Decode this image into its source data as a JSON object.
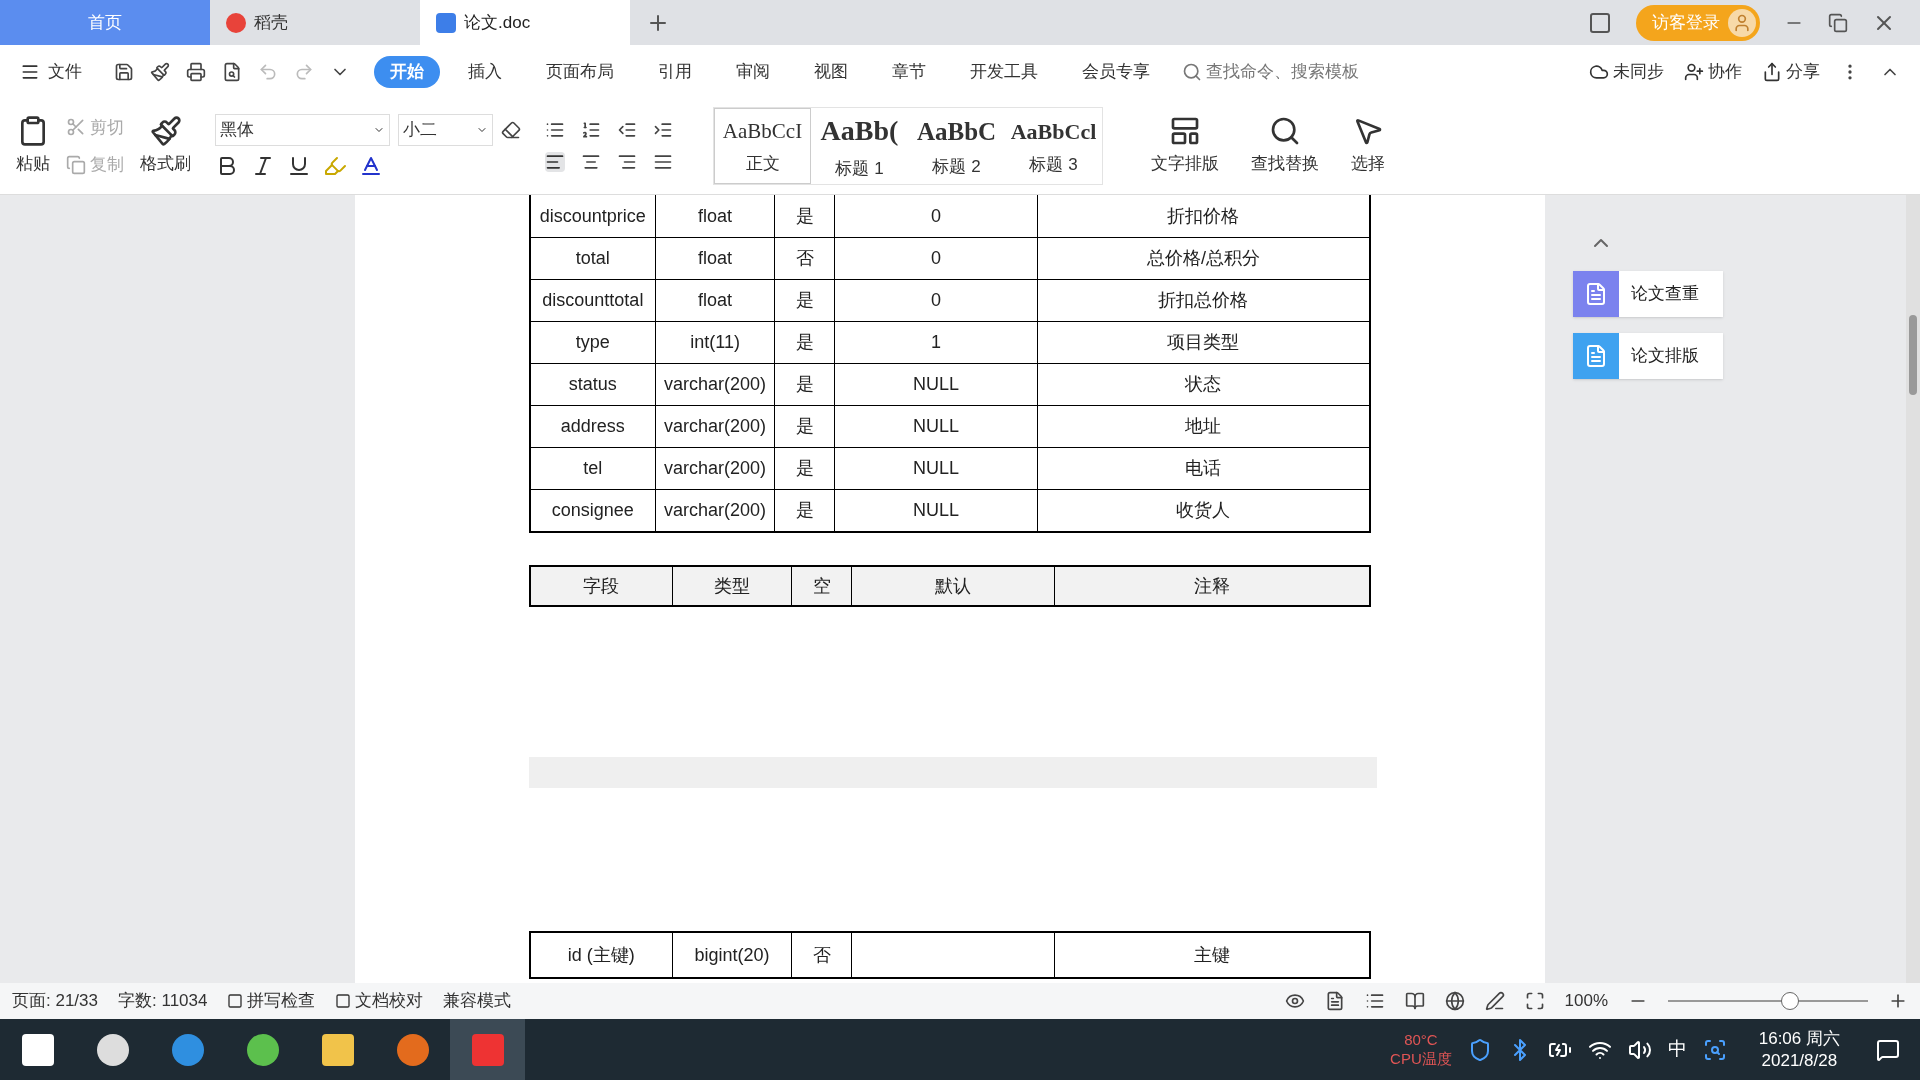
{
  "doc_tabs": [
    {
      "label": "首页",
      "kind": "home",
      "selected": false
    },
    {
      "label": "稻壳",
      "kind": "docer",
      "selected": false
    },
    {
      "label": "论文.doc",
      "kind": "doc",
      "selected": true
    }
  ],
  "login_button": "访客登录",
  "file_menu": "文件",
  "ribbon_tabs": [
    {
      "label": "开始",
      "selected": true
    },
    {
      "label": "插入",
      "selected": false
    },
    {
      "label": "页面布局",
      "selected": false
    },
    {
      "label": "引用",
      "selected": false
    },
    {
      "label": "审阅",
      "selected": false
    },
    {
      "label": "视图",
      "selected": false
    },
    {
      "label": "章节",
      "selected": false
    },
    {
      "label": "开发工具",
      "selected": false
    },
    {
      "label": "会员专享",
      "selected": false
    }
  ],
  "command_search": {
    "placeholder": "查找命令、搜索模板"
  },
  "top_actions": [
    "未同步",
    "协作",
    "分享"
  ],
  "clipboard": {
    "paste": "粘贴",
    "cut": "剪切",
    "copy": "复制",
    "format_painter": "格式刷"
  },
  "font": {
    "family": "黑体",
    "size": "小二",
    "bold": false,
    "italic": false,
    "underline": false
  },
  "styles": [
    {
      "sample": "AaBbCcI",
      "name": "正文",
      "kind": "body",
      "selected": true
    },
    {
      "sample": "AaBb(",
      "name": "标题 1",
      "kind": "h1",
      "selected": false
    },
    {
      "sample": "AaBbC",
      "name": "标题 2",
      "kind": "h2",
      "selected": false
    },
    {
      "sample": "AaBbCcl",
      "name": "标题 3",
      "kind": "h3",
      "selected": false
    }
  ],
  "big_tools": [
    "文字排版",
    "查找替换",
    "选择"
  ],
  "side_panel": [
    "论文查重",
    "论文排版"
  ],
  "table_1": {
    "rows": [
      [
        "discountprice",
        "float",
        "是",
        "0",
        "折扣价格"
      ],
      [
        "total",
        "float",
        "否",
        "0",
        "总价格/总积分"
      ],
      [
        "discounttotal",
        "float",
        "是",
        "0",
        "折扣总价格"
      ],
      [
        "type",
        "int(11)",
        "是",
        "1",
        "项目类型"
      ],
      [
        "status",
        "varchar(200)",
        "是",
        "NULL",
        "状态"
      ],
      [
        "address",
        "varchar(200)",
        "是",
        "NULL",
        "地址"
      ],
      [
        "tel",
        "varchar(200)",
        "是",
        "NULL",
        "电话"
      ],
      [
        "consignee",
        "varchar(200)",
        "是",
        "NULL",
        "收货人"
      ]
    ]
  },
  "table_2": {
    "columns": [
      "字段",
      "类型",
      "空",
      "默认",
      "注释"
    ]
  },
  "table_3": {
    "rows": [
      [
        "id (主键)",
        "bigint(20)",
        "否",
        "",
        "主键"
      ]
    ]
  },
  "status_bar": {
    "page": "页面: 21/33",
    "words": "字数: 11034",
    "spell_check": "拼写检查",
    "proofread": "文档校对",
    "mode": "兼容模式",
    "zoom": "100%",
    "zoom_slider": {
      "level": 0.62
    }
  },
  "taskbar": {
    "cpu_temp": "80°C",
    "cpu_label": "CPU温度",
    "ime": "中",
    "time": "16:06 周六",
    "date": "2021/8/28"
  }
}
